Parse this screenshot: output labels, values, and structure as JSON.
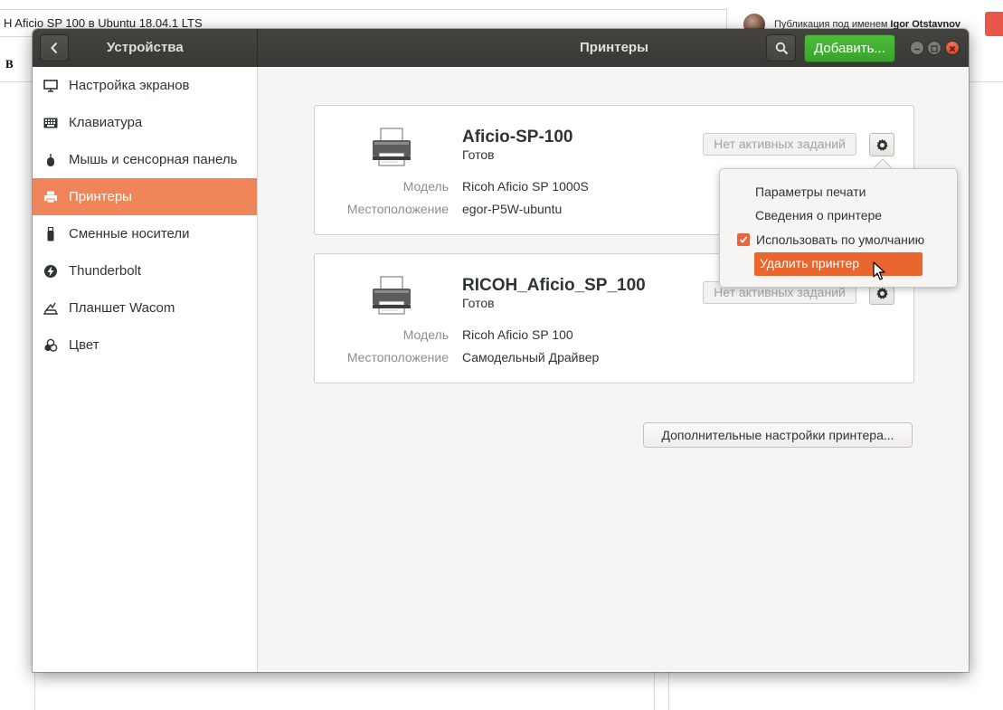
{
  "background_page": {
    "title_text": "H Aficio SP 100  в Ubuntu 18.04.1 LTS",
    "publish_label": "Публикация под именем",
    "publish_user": "Igor Otstavnov",
    "bold_tool": "B"
  },
  "window": {
    "left_title": "Устройства",
    "center_title": "Принтеры",
    "add_button": "Добавить..."
  },
  "sidebar": {
    "items": [
      {
        "label": "Настройка экранов",
        "icon": "display-icon"
      },
      {
        "label": "Клавиатура",
        "icon": "keyboard-icon"
      },
      {
        "label": "Мышь и сенсорная панель",
        "icon": "mouse-icon"
      },
      {
        "label": "Принтеры",
        "icon": "printer-icon",
        "active": true
      },
      {
        "label": "Сменные носители",
        "icon": "usb-drive-icon"
      },
      {
        "label": "Thunderbolt",
        "icon": "thunderbolt-icon"
      },
      {
        "label": "Планшет Wacom",
        "icon": "tablet-icon"
      },
      {
        "label": "Цвет",
        "icon": "color-icon"
      }
    ]
  },
  "printers": [
    {
      "name": "Aficio-SP-100",
      "status": "Готов",
      "model_label": "Модель",
      "model": "Ricoh Aficio SP 1000S",
      "location_label": "Местоположение",
      "location": "egor-P5W-ubuntu",
      "jobs_button": "Нет активных заданий"
    },
    {
      "name": "RICOH_Aficio_SP_100",
      "status": "Готов",
      "model_label": "Модель",
      "model": "Ricoh Aficio SP 100",
      "location_label": "Местоположение",
      "location": "Самодельный Драйвер",
      "jobs_button": "Нет активных заданий"
    }
  ],
  "more_settings_button": "Дополнительные настройки принтера...",
  "popover_menu": {
    "items": [
      {
        "label": "Параметры печати"
      },
      {
        "label": "Сведения о принтере"
      },
      {
        "label": "Использовать по умолчанию",
        "checked": true
      },
      {
        "label": "Удалить принтер",
        "highlighted": true
      }
    ]
  },
  "colors": {
    "accent": "#f08559",
    "add_button": "#43b134",
    "titlebar": "#3e3c38",
    "danger_highlight": "#e9662f"
  }
}
